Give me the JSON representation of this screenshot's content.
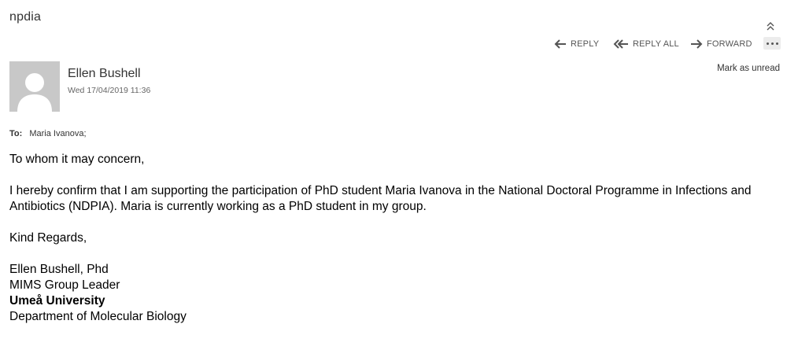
{
  "email": {
    "subject": "npdia",
    "toolbar": {
      "reply": "REPLY",
      "reply_all": "REPLY ALL",
      "forward": "FORWARD",
      "mark_unread": "Mark as unread"
    },
    "sender": {
      "name": "Ellen Bushell",
      "date": "Wed 17/04/2019 11:36"
    },
    "to": {
      "label": "To:",
      "recipient": "Maria Ivanova;"
    },
    "body": {
      "greeting": "To whom it may concern,",
      "paragraph": "I hereby confirm that I am supporting the participation of PhD student Maria Ivanova in the National Doctoral Programme in Infections and Antibiotics (NDPIA). Maria is currently working as a PhD student in my group.",
      "closing": "Kind Regards,",
      "signature": {
        "name": "Ellen Bushell, Phd",
        "title": "MIMS Group Leader",
        "university": "Umeå University",
        "department": "Department of Molecular Biology"
      }
    }
  },
  "icons": {
    "collapse": "chevron-double-up-icon",
    "reply": "reply-arrow-icon",
    "reply_all": "reply-all-arrow-icon",
    "forward": "forward-arrow-icon",
    "more": "ellipsis-icon",
    "avatar": "person-silhouette-icon"
  },
  "colors": {
    "text": "#333333",
    "body_text": "#000000",
    "muted": "#666666",
    "avatar_bg": "#c8c8c8"
  }
}
